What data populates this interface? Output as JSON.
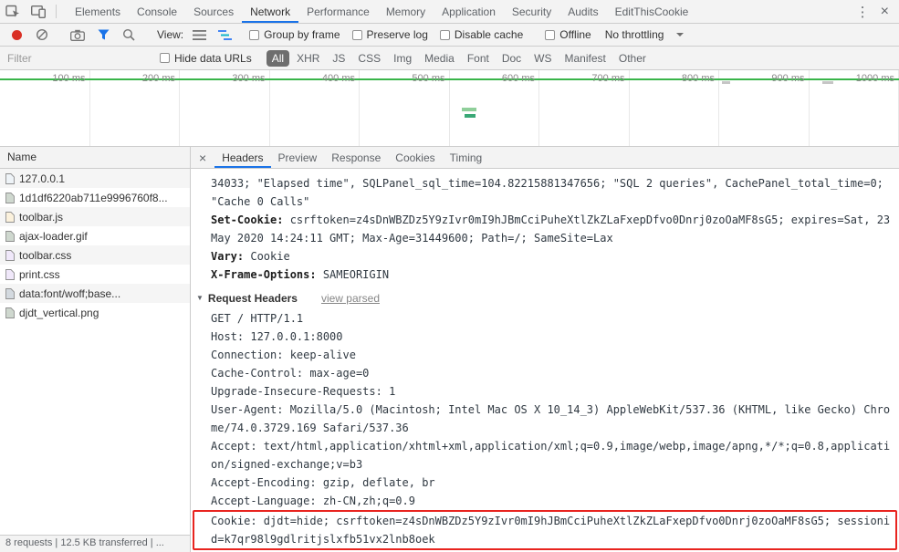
{
  "window_controls": {
    "menu": "⋮",
    "close": "×"
  },
  "main_tabs": {
    "items": [
      {
        "label": "Elements",
        "state": ""
      },
      {
        "label": "Console",
        "state": ""
      },
      {
        "label": "Sources",
        "state": ""
      },
      {
        "label": "Network",
        "state": "active"
      },
      {
        "label": "Performance",
        "state": ""
      },
      {
        "label": "Memory",
        "state": ""
      },
      {
        "label": "Application",
        "state": ""
      },
      {
        "label": "Security",
        "state": ""
      },
      {
        "label": "Audits",
        "state": ""
      },
      {
        "label": "EditThisCookie",
        "state": ""
      }
    ]
  },
  "toolbar": {
    "view_label": "View:",
    "group_by_frame": "Group by frame",
    "preserve_log": "Preserve log",
    "disable_cache": "Disable cache",
    "offline": "Offline",
    "throttling": "No throttling"
  },
  "filter_bar": {
    "filter_placeholder": "Filter",
    "hide_data_urls": "Hide data URLs",
    "types": [
      {
        "label": "All",
        "state": "active"
      },
      {
        "label": "XHR",
        "state": ""
      },
      {
        "label": "JS",
        "state": ""
      },
      {
        "label": "CSS",
        "state": ""
      },
      {
        "label": "Img",
        "state": ""
      },
      {
        "label": "Media",
        "state": ""
      },
      {
        "label": "Font",
        "state": ""
      },
      {
        "label": "Doc",
        "state": ""
      },
      {
        "label": "WS",
        "state": ""
      },
      {
        "label": "Manifest",
        "state": ""
      },
      {
        "label": "Other",
        "state": ""
      }
    ]
  },
  "overview": {
    "ticks": [
      "100 ms",
      "200 ms",
      "300 ms",
      "400 ms",
      "500 ms",
      "600 ms",
      "700 ms",
      "800 ms",
      "900 ms",
      "1000 ms"
    ]
  },
  "request_table": {
    "name_header": "Name",
    "rows": [
      {
        "name": "127.0.0.1",
        "icon": "doc"
      },
      {
        "name": "1d1df6220ab711e9996760f8...",
        "icon": "img"
      },
      {
        "name": "toolbar.js",
        "icon": "js"
      },
      {
        "name": "ajax-loader.gif",
        "icon": "img"
      },
      {
        "name": "toolbar.css",
        "icon": "css"
      },
      {
        "name": "print.css",
        "icon": "css"
      },
      {
        "name": "data:font/woff;base...",
        "icon": "font"
      },
      {
        "name": "djdt_vertical.png",
        "icon": "img"
      }
    ]
  },
  "details": {
    "close": "×",
    "disclosure_triangle": "▼",
    "tabs": [
      {
        "label": "Headers",
        "state": "active"
      },
      {
        "label": "Preview",
        "state": ""
      },
      {
        "label": "Response",
        "state": ""
      },
      {
        "label": "Cookies",
        "state": ""
      },
      {
        "label": "Timing",
        "state": ""
      }
    ],
    "response_tail": [
      {
        "name": "",
        "value": "34033; \"Elapsed time\", SQLPanel_sql_time=104.82215881347656; \"SQL 2 queries\", CachePanel_total_time=0; \"Cache 0 Calls\""
      },
      {
        "name": "Set-Cookie:",
        "value": " csrftoken=z4sDnWBZDz5Y9zIvr0mI9hJBmCciPuheXtlZkZLaFxepDfvo0Dnrj0zoOaMF8sG5; expires=Sat, 23 May 2020 14:24:11 GMT; Max-Age=31449600; Path=/; SameSite=Lax"
      },
      {
        "name": "Vary:",
        "value": " Cookie"
      },
      {
        "name": "X-Frame-Options:",
        "value": " SAMEORIGIN"
      }
    ],
    "request_headers_title": "Request Headers",
    "view_parsed_label": "view parsed",
    "request_lines": [
      "GET / HTTP/1.1",
      "Host: 127.0.0.1:8000",
      "Connection: keep-alive",
      "Cache-Control: max-age=0",
      "Upgrade-Insecure-Requests: 1",
      "User-Agent: Mozilla/5.0 (Macintosh; Intel Mac OS X 10_14_3) AppleWebKit/537.36 (KHTML, like Gecko) Chrome/74.0.3729.169 Safari/537.36",
      "Accept: text/html,application/xhtml+xml,application/xml;q=0.9,image/webp,image/apng,*/*;q=0.8,application/signed-exchange;v=b3",
      "Accept-Encoding: gzip, deflate, br",
      "Accept-Language: zh-CN,zh;q=0.9"
    ],
    "cookie_line": "Cookie: djdt=hide; csrftoken=z4sDnWBZDz5Y9zIvr0mI9hJBmCciPuheXtlZkZLaFxepDfvo0Dnrj0zoOaMF8sG5; sessionid=k7qr98l9gdlritjslxfb51vx2lnb8oek"
  },
  "status_bar": {
    "summary": "8 requests | 12.5 KB transferred | ..."
  },
  "colors": {
    "accent_blue": "#1a73e8",
    "record_red": "#d93025",
    "overview_green": "#39b54a",
    "cookie_highlight_red": "#e8241f",
    "active_filter_bg": "#6e6e6e"
  }
}
